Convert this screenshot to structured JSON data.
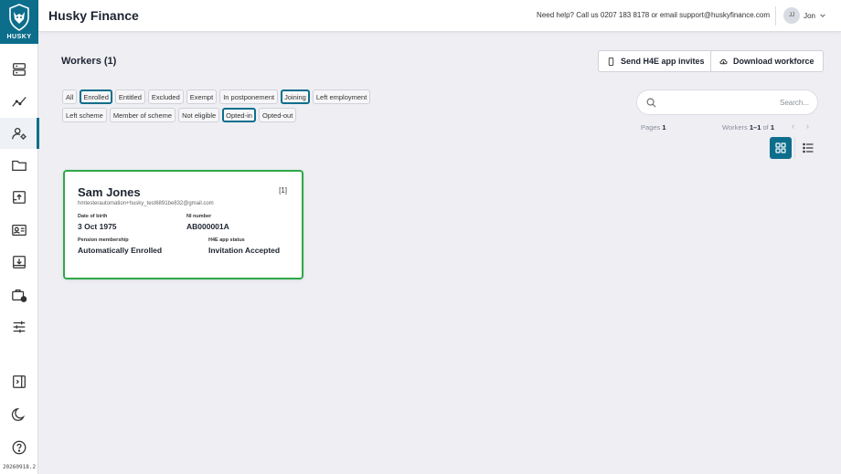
{
  "sidebar": {
    "logo_text": "HUSKY",
    "version": "20260918.2",
    "items": [
      {
        "icon": "server-icon"
      },
      {
        "icon": "trend-chart-icon"
      },
      {
        "icon": "workers-settings-icon",
        "active": true
      },
      {
        "icon": "folder-icon"
      },
      {
        "icon": "upload-tray-icon"
      },
      {
        "icon": "id-card-icon"
      },
      {
        "icon": "download-tray-icon"
      },
      {
        "icon": "briefcase-clock-icon"
      },
      {
        "icon": "sliders-icon"
      }
    ],
    "bottom_items": [
      {
        "icon": "collapse-panel-icon"
      },
      {
        "icon": "moon-icon"
      },
      {
        "icon": "help-icon"
      }
    ]
  },
  "header": {
    "title": "Husky Finance",
    "help_text": "Need help? Call us 0207 183 8178 or email support@huskyfinance.com",
    "user_initials": "JJ",
    "user_name": "Jon"
  },
  "main": {
    "page_title": "Workers (1)",
    "send_invites_label": "Send H4E app invites",
    "download_label": "Download workforce",
    "filters_row1": [
      {
        "label": "All",
        "selected": false
      },
      {
        "label": "Enrolled",
        "selected": true
      },
      {
        "label": "Entitled",
        "selected": false
      },
      {
        "label": "Excluded",
        "selected": false
      },
      {
        "label": "Exempt",
        "selected": false
      },
      {
        "label": "In postponement",
        "selected": false
      },
      {
        "label": "Joining",
        "selected": true
      },
      {
        "label": "Left employment",
        "selected": false
      }
    ],
    "filters_row2": [
      {
        "label": "Left scheme",
        "selected": false
      },
      {
        "label": "Member of scheme",
        "selected": false
      },
      {
        "label": "Not eligible",
        "selected": false
      },
      {
        "label": "Opted-in",
        "selected": true
      },
      {
        "label": "Opted-out",
        "selected": false
      }
    ],
    "search": {
      "placeholder": "Search..."
    },
    "pager": {
      "pages_label": "Pages",
      "pages_value": "1",
      "workers_label": "Workers",
      "workers_range": "1–1",
      "of_label": "of",
      "workers_total": "1"
    }
  },
  "worker_card": {
    "name": "Sam Jones",
    "index": "[1]",
    "email": "hmtesterautomation+husky_test6891be832@gmail.com",
    "dob_label": "Date of birth",
    "dob": "3 Oct 1975",
    "ni_label": "NI number",
    "ni": "AB000001A",
    "pension_label": "Pension membership",
    "pension": "Automatically Enrolled",
    "app_status_label": "H4E app status",
    "app_status": "Invitation Accepted"
  },
  "colors": {
    "accent": "#0d6e8c",
    "selected_card_border": "#2ea84a"
  }
}
